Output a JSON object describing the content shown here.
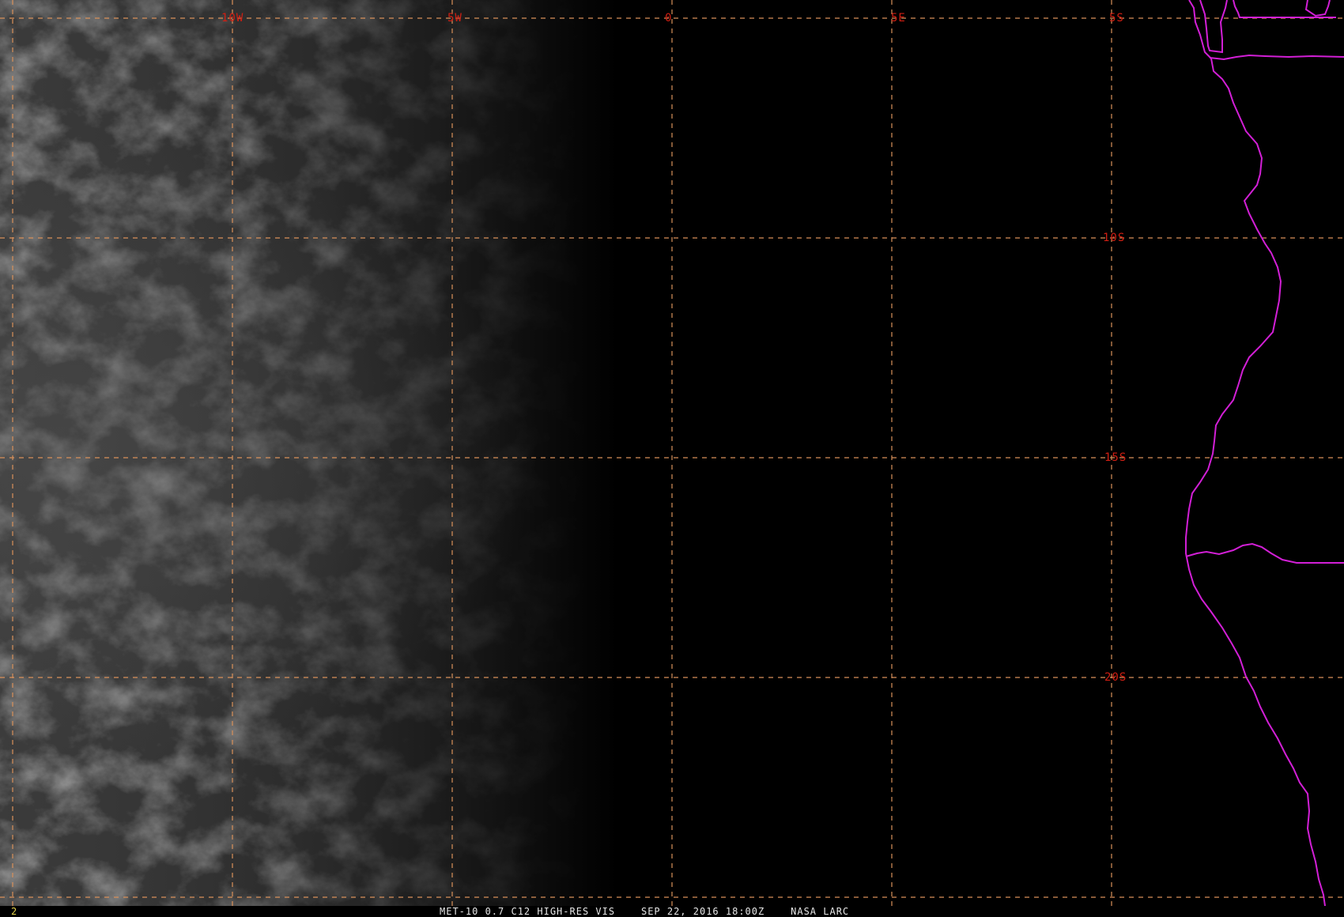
{
  "status": {
    "frame_number": "2",
    "caption": "MET-10 0.7 C12 HIGH-RES VIS    SEP 22, 2016 18:00Z    NASA LARC"
  },
  "map": {
    "longitude_labels": [
      "10W",
      "5W",
      "0",
      "5E"
    ],
    "latitude_labels": [
      "5S",
      "10S",
      "15S",
      "20S"
    ],
    "colors": {
      "grid": "#d9915a",
      "grid_labels": "#d21e12",
      "coastline": "#d21fd6",
      "status_text": "#e6e6e6",
      "frame_number": "#e3d34a"
    },
    "layers": [
      "visible-satellite-imagery",
      "lat-lon-grid",
      "coastline-and-borders"
    ]
  }
}
